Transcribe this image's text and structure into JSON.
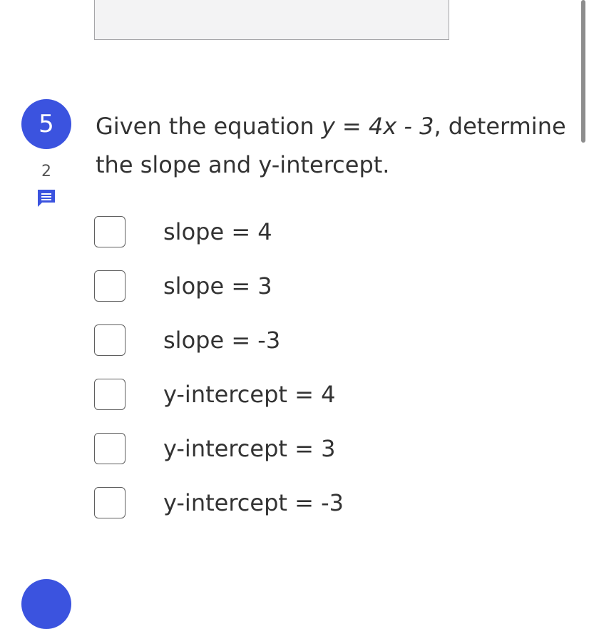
{
  "question": {
    "number": "5",
    "points": "2",
    "text_before": "Given the equation ",
    "equation": "y = 4x - 3",
    "text_after": ", determine the slope and y-intercept."
  },
  "options": [
    {
      "label": "slope = 4",
      "checked": false
    },
    {
      "label": "slope = 3",
      "checked": false
    },
    {
      "label": "slope = -3",
      "checked": false
    },
    {
      "label": "y-intercept = 4",
      "checked": false
    },
    {
      "label": "y-intercept = 3",
      "checked": false
    },
    {
      "label": "y-intercept = -3",
      "checked": false
    }
  ],
  "colors": {
    "accent": "#3b53df",
    "text": "#333333",
    "checkbox_border": "#5f5f5f"
  },
  "icons": {
    "comment": "comment-icon"
  }
}
